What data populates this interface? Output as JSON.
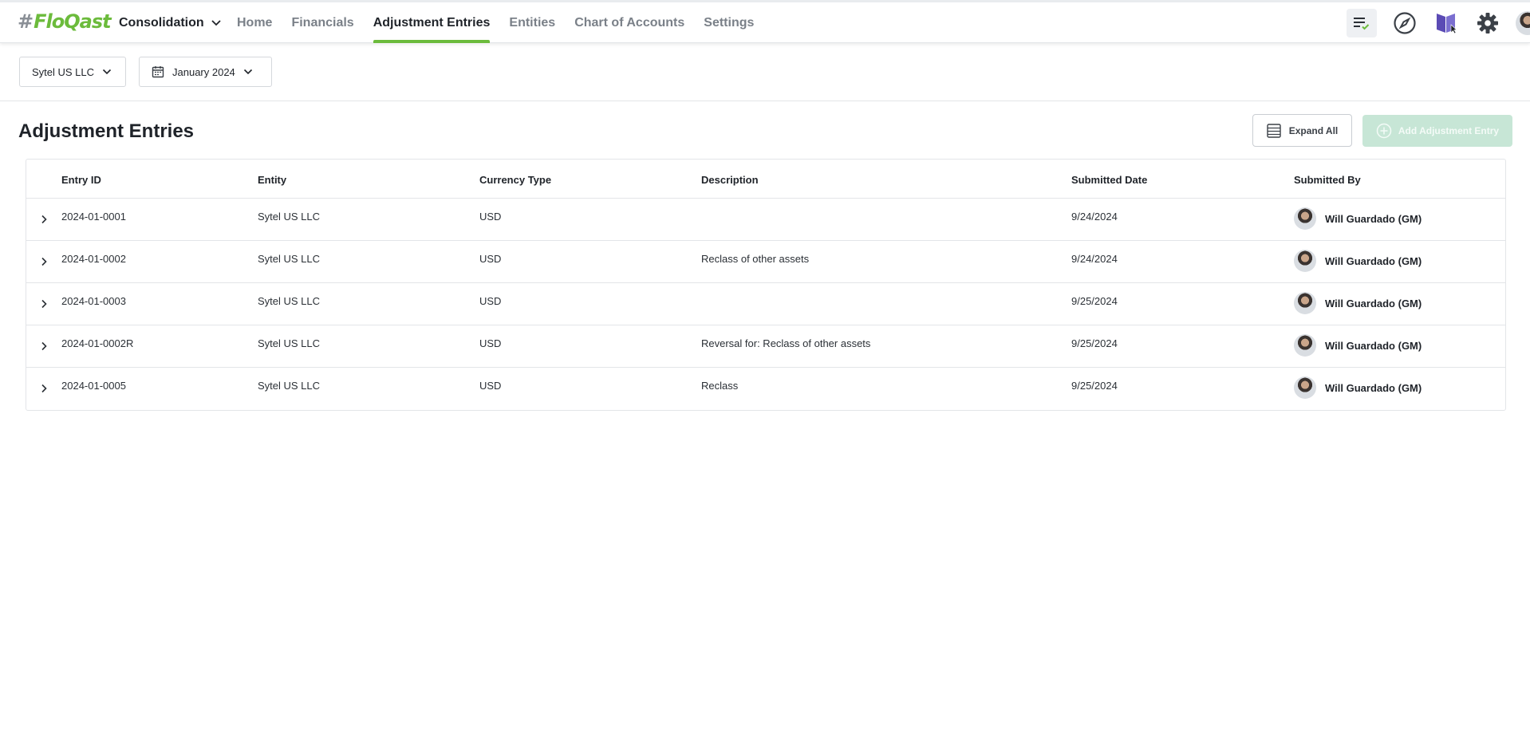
{
  "header": {
    "logo_hash": "#",
    "logo_text": "FloQast",
    "app_switcher": "Consolidation",
    "nav": [
      {
        "label": "Home"
      },
      {
        "label": "Financials"
      },
      {
        "label": "Adjustment Entries",
        "active": true
      },
      {
        "label": "Entities"
      },
      {
        "label": "Chart of Accounts"
      },
      {
        "label": "Settings"
      }
    ],
    "icons": [
      "tasks-icon",
      "compass-icon",
      "book-icon",
      "gear-icon",
      "user-avatar"
    ]
  },
  "filters": {
    "entity": "Sytel US LLC",
    "period": "January 2024"
  },
  "page": {
    "title": "Adjustment Entries",
    "expand_all": "Expand All",
    "add_entry": "Add Adjustment Entry"
  },
  "table": {
    "columns": [
      "Entry ID",
      "Entity",
      "Currency Type",
      "Description",
      "Submitted Date",
      "Submitted By"
    ],
    "rows": [
      {
        "id": "2024-01-0001",
        "entity": "Sytel US LLC",
        "currency": "USD",
        "description": "",
        "date": "9/24/2024",
        "by": "Will Guardado (GM)"
      },
      {
        "id": "2024-01-0002",
        "entity": "Sytel US LLC",
        "currency": "USD",
        "description": "Reclass of other assets",
        "date": "9/24/2024",
        "by": "Will Guardado (GM)"
      },
      {
        "id": "2024-01-0003",
        "entity": "Sytel US LLC",
        "currency": "USD",
        "description": "",
        "date": "9/25/2024",
        "by": "Will Guardado (GM)"
      },
      {
        "id": "2024-01-0002R",
        "entity": "Sytel US LLC",
        "currency": "USD",
        "description": "Reversal for: Reclass of other assets",
        "date": "9/25/2024",
        "by": "Will Guardado (GM)"
      },
      {
        "id": "2024-01-0005",
        "entity": "Sytel US LLC",
        "currency": "USD",
        "description": "Reclass",
        "date": "9/25/2024",
        "by": "Will Guardado (GM)"
      }
    ]
  },
  "colors": {
    "brand": "#6cbb3c",
    "add_button_disabled": "#c7e6d6",
    "book_icon": "#5b4bb5"
  }
}
